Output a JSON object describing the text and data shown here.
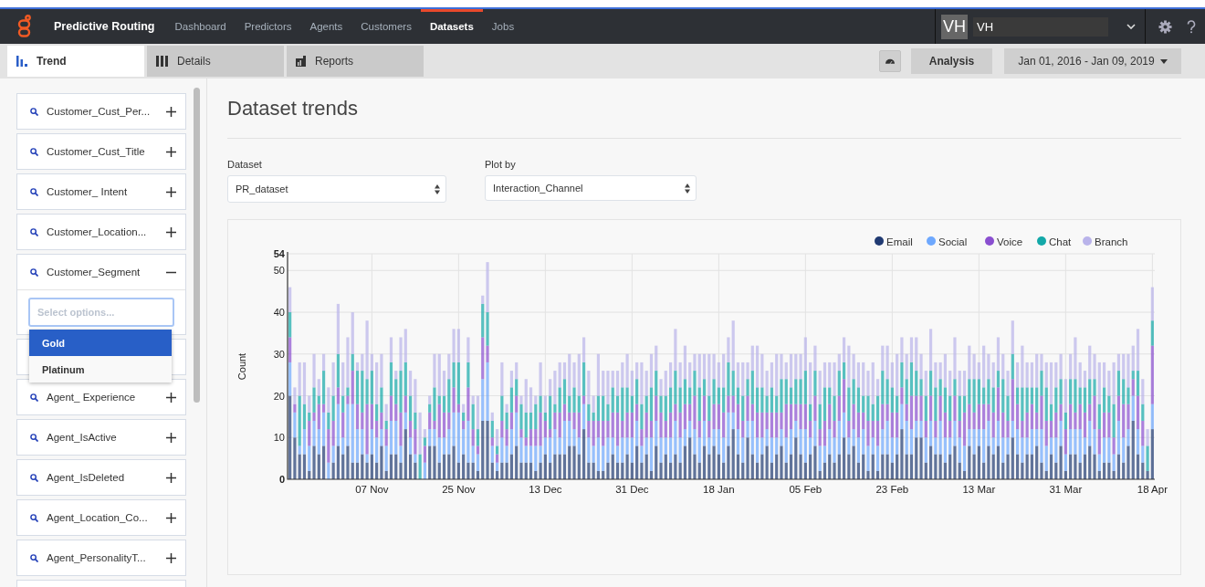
{
  "header": {
    "app_name": "Predictive Routing",
    "nav": [
      {
        "label": "Dashboard",
        "selected": false
      },
      {
        "label": "Predictors",
        "selected": false
      },
      {
        "label": "Agents",
        "selected": false
      },
      {
        "label": "Customers",
        "selected": false
      },
      {
        "label": "Datasets",
        "selected": true
      },
      {
        "label": "Jobs",
        "selected": false
      }
    ],
    "user": {
      "initials": "VH",
      "name": "VH"
    }
  },
  "tabs": [
    {
      "label": "Trend",
      "kind": "trend",
      "selected": true
    },
    {
      "label": "Details",
      "kind": "details",
      "selected": false
    },
    {
      "label": "Reports",
      "kind": "reports",
      "selected": false
    }
  ],
  "toolbar": {
    "analysis_button": "Analysis",
    "date_range": "Jan 01, 2016 - Jan 09, 2019"
  },
  "sidebar": {
    "filters": [
      {
        "name": "Customer_Cust_Per...",
        "expanded": false
      },
      {
        "name": "Customer_Cust_Title",
        "expanded": false
      },
      {
        "name": "Customer_ Intent",
        "expanded": false
      },
      {
        "name": "Customer_Location...",
        "expanded": false
      },
      {
        "name": "Customer_Segment",
        "expanded": true,
        "placeholder": "Select options...",
        "options": [
          {
            "label": "Gold",
            "selected": true
          },
          {
            "label": "Platinum",
            "selected": false
          }
        ]
      },
      {
        "kind": "covered"
      },
      {
        "name": "Agent_ Experience",
        "expanded": false
      },
      {
        "name": "Agent_IsActive",
        "expanded": false
      },
      {
        "name": "Agent_IsDeleted",
        "expanded": false
      },
      {
        "name": "Agent_Location_Co...",
        "expanded": false
      },
      {
        "name": "Agent_PersonalityT...",
        "expanded": false
      },
      {
        "kind": "covered"
      }
    ]
  },
  "main": {
    "title": "Dataset trends",
    "dataset": {
      "label": "Dataset",
      "value": "PR_dataset"
    },
    "plot_by": {
      "label": "Plot by",
      "value": "Interaction_Channel"
    },
    "chart_data": {
      "type": "bar",
      "stacked": true,
      "grid": true,
      "legend": true,
      "ylabel": "Count",
      "ylim": [
        0,
        54
      ],
      "yticks": [
        0,
        10,
        20,
        30,
        40,
        50,
        54
      ],
      "categories": [
        null,
        null,
        null,
        null,
        null,
        null,
        null,
        null,
        null,
        null,
        null,
        null,
        null,
        null,
        null,
        null,
        null,
        "07 Nov",
        null,
        null,
        null,
        null,
        null,
        null,
        null,
        null,
        null,
        null,
        null,
        null,
        null,
        null,
        null,
        null,
        null,
        "25 Nov",
        null,
        null,
        null,
        null,
        null,
        null,
        null,
        null,
        null,
        null,
        null,
        null,
        null,
        null,
        null,
        null,
        null,
        "13 Dec",
        null,
        null,
        null,
        null,
        null,
        null,
        null,
        null,
        null,
        null,
        null,
        null,
        null,
        null,
        null,
        null,
        null,
        "31 Dec",
        null,
        null,
        null,
        null,
        null,
        null,
        null,
        null,
        null,
        null,
        null,
        null,
        null,
        null,
        null,
        null,
        null,
        "18 Jan",
        null,
        null,
        null,
        null,
        null,
        null,
        null,
        null,
        null,
        null,
        null,
        null,
        null,
        null,
        null,
        null,
        null,
        "05 Feb",
        null,
        null,
        null,
        null,
        null,
        null,
        null,
        null,
        null,
        null,
        null,
        null,
        null,
        null,
        null,
        null,
        null,
        "23 Feb",
        null,
        null,
        null,
        null,
        null,
        null,
        null,
        null,
        null,
        null,
        null,
        null,
        null,
        null,
        null,
        null,
        null,
        "13 Mar",
        null,
        null,
        null,
        null,
        null,
        null,
        null,
        null,
        null,
        null,
        null,
        null,
        null,
        null,
        null,
        null,
        null,
        "31 Mar",
        null,
        null,
        null,
        null,
        null,
        null,
        null,
        null,
        null,
        null,
        null,
        null,
        null,
        null,
        null,
        null,
        null,
        "18 Apr"
      ],
      "series": [
        {
          "name": "Email",
          "color": "#203a72",
          "values": [
            20,
            10,
            6,
            6,
            2,
            8,
            6,
            8,
            0,
            4,
            8,
            6,
            8,
            4,
            4,
            6,
            4,
            6,
            4,
            8,
            2,
            6,
            6,
            4,
            12,
            6,
            4,
            0,
            0,
            8,
            8,
            4,
            6,
            6,
            8,
            4,
            6,
            4,
            4,
            2,
            14,
            14,
            4,
            2,
            4,
            4,
            6,
            8,
            4,
            4,
            4,
            2,
            4,
            6,
            4,
            6,
            6,
            6,
            8,
            8,
            6,
            12,
            4,
            4,
            2,
            2,
            4,
            6,
            4,
            4,
            6,
            4,
            8,
            4,
            6,
            2,
            8,
            4,
            6,
            4,
            6,
            4,
            8,
            10,
            6,
            4,
            8,
            6,
            8,
            6,
            4,
            8,
            12,
            6,
            4,
            10,
            6,
            4,
            6,
            8,
            4,
            6,
            8,
            4,
            6,
            10,
            6,
            4,
            6,
            8,
            2,
            4,
            6,
            4,
            6,
            10,
            6,
            8,
            4,
            6,
            2,
            6,
            2,
            6,
            6,
            4,
            6,
            12,
            6,
            6,
            10,
            10,
            4,
            8,
            6,
            6,
            4,
            6,
            8,
            4,
            2,
            8,
            6,
            8,
            4,
            8,
            6,
            8,
            4,
            6,
            10,
            6,
            4,
            6,
            6,
            8,
            4,
            2,
            6,
            4,
            8,
            2,
            6,
            6,
            4,
            6,
            8,
            6,
            2,
            4,
            4,
            2,
            6,
            4,
            8,
            14,
            6,
            4,
            2,
            12
          ]
        },
        {
          "name": "Social",
          "color": "#6ea8fe",
          "values": [
            8,
            6,
            2,
            6,
            6,
            6,
            6,
            8,
            4,
            4,
            10,
            4,
            10,
            14,
            8,
            6,
            2,
            6,
            6,
            4,
            6,
            8,
            8,
            4,
            4,
            4,
            2,
            0,
            4,
            4,
            4,
            6,
            4,
            6,
            8,
            12,
            6,
            10,
            4,
            4,
            10,
            14,
            4,
            2,
            6,
            4,
            6,
            8,
            6,
            4,
            4,
            6,
            4,
            4,
            6,
            6,
            4,
            8,
            6,
            4,
            4,
            6,
            6,
            4,
            8,
            6,
            6,
            4,
            4,
            6,
            4,
            6,
            6,
            4,
            4,
            8,
            6,
            6,
            4,
            6,
            8,
            6,
            4,
            4,
            6,
            6,
            6,
            4,
            4,
            6,
            6,
            8,
            4,
            6,
            6,
            4,
            8,
            6,
            4,
            4,
            6,
            4,
            4,
            6,
            6,
            4,
            6,
            8,
            4,
            6,
            6,
            4,
            6,
            6,
            8,
            6,
            4,
            4,
            6,
            6,
            6,
            4,
            6,
            6,
            8,
            6,
            4,
            6,
            8,
            6,
            4,
            4,
            6,
            6,
            4,
            8,
            6,
            4,
            6,
            6,
            6,
            4,
            6,
            4,
            8,
            6,
            4,
            6,
            6,
            4,
            4,
            6,
            6,
            4,
            6,
            4,
            8,
            6,
            4,
            6,
            6,
            4,
            6,
            6,
            8,
            4,
            6,
            6,
            4,
            6,
            6,
            4,
            8,
            6,
            4,
            6,
            6,
            4,
            0,
            6
          ]
        },
        {
          "name": "Voice",
          "color": "#8a4fd0",
          "values": [
            6,
            2,
            0,
            0,
            6,
            2,
            6,
            2,
            8,
            6,
            4,
            6,
            2,
            8,
            6,
            4,
            12,
            6,
            4,
            4,
            4,
            6,
            4,
            8,
            4,
            4,
            6,
            0,
            4,
            4,
            2,
            8,
            6,
            4,
            6,
            2,
            2,
            8,
            4,
            2,
            10,
            4,
            2,
            2,
            4,
            4,
            4,
            4,
            2,
            2,
            4,
            4,
            8,
            4,
            2,
            4,
            6,
            4,
            2,
            4,
            6,
            2,
            4,
            6,
            4,
            6,
            4,
            6,
            8,
            4,
            6,
            6,
            4,
            4,
            6,
            4,
            6,
            6,
            4,
            6,
            4,
            6,
            6,
            4,
            8,
            4,
            6,
            4,
            6,
            6,
            6,
            4,
            4,
            6,
            4,
            6,
            4,
            6,
            6,
            4,
            6,
            6,
            4,
            8,
            6,
            4,
            6,
            6,
            4,
            6,
            4,
            6,
            6,
            4,
            6,
            8,
            4,
            6,
            6,
            4,
            6,
            4,
            6,
            6,
            4,
            6,
            6,
            4,
            4,
            8,
            6,
            6,
            4,
            6,
            4,
            6,
            6,
            4,
            6,
            4,
            8,
            6,
            4,
            6,
            6,
            4,
            6,
            8,
            6,
            4,
            10,
            6,
            4,
            6,
            6,
            4,
            8,
            6,
            4,
            6,
            4,
            6,
            6,
            4,
            6,
            6,
            4,
            8,
            6,
            6,
            6,
            4,
            6,
            8,
            6,
            4,
            8,
            6,
            0,
            14
          ]
        },
        {
          "name": "Chat",
          "color": "#13a8a8",
          "values": [
            6,
            0,
            12,
            6,
            2,
            6,
            2,
            8,
            4,
            6,
            8,
            4,
            2,
            4,
            8,
            10,
            6,
            8,
            4,
            6,
            2,
            8,
            6,
            10,
            8,
            6,
            4,
            6,
            2,
            2,
            8,
            2,
            4,
            8,
            6,
            10,
            2,
            6,
            6,
            4,
            8,
            8,
            4,
            2,
            6,
            4,
            6,
            4,
            6,
            6,
            4,
            6,
            4,
            2,
            8,
            2,
            6,
            6,
            4,
            6,
            4,
            8,
            4,
            2,
            6,
            6,
            4,
            6,
            4,
            8,
            6,
            4,
            6,
            6,
            4,
            8,
            6,
            4,
            6,
            6,
            8,
            6,
            6,
            4,
            6,
            8,
            4,
            6,
            6,
            4,
            6,
            8,
            6,
            4,
            6,
            4,
            8,
            6,
            6,
            4,
            6,
            4,
            8,
            6,
            4,
            6,
            6,
            8,
            4,
            6,
            6,
            8,
            4,
            6,
            6,
            4,
            8,
            6,
            6,
            4,
            6,
            4,
            6,
            8,
            6,
            6,
            4,
            6,
            6,
            8,
            6,
            4,
            6,
            6,
            8,
            4,
            6,
            6,
            4,
            6,
            4,
            6,
            8,
            6,
            4,
            6,
            6,
            4,
            8,
            6,
            6,
            4,
            8,
            6,
            4,
            6,
            6,
            8,
            4,
            6,
            6,
            4,
            6,
            8,
            4,
            6,
            6,
            4,
            6,
            6,
            4,
            8,
            6,
            6,
            4,
            2,
            6,
            4,
            6,
            6
          ]
        },
        {
          "name": "Branch",
          "color": "#b9b3ea",
          "values": [
            6,
            4,
            8,
            10,
            4,
            8,
            4,
            4,
            6,
            8,
            12,
            8,
            12,
            10,
            2,
            4,
            14,
            4,
            10,
            8,
            4,
            6,
            2,
            8,
            8,
            6,
            8,
            10,
            2,
            2,
            8,
            10,
            6,
            6,
            8,
            8,
            2,
            6,
            2,
            8,
            2,
            12,
            2,
            4,
            8,
            2,
            4,
            4,
            2,
            8,
            6,
            2,
            8,
            4,
            4,
            8,
            6,
            4,
            10,
            6,
            10,
            6,
            8,
            4,
            10,
            6,
            8,
            4,
            6,
            6,
            8,
            6,
            4,
            10,
            6,
            8,
            6,
            4,
            6,
            6,
            10,
            6,
            8,
            6,
            4,
            8,
            6,
            10,
            6,
            6,
            8,
            6,
            12,
            6,
            8,
            4,
            6,
            10,
            8,
            6,
            6,
            10,
            6,
            4,
            8,
            6,
            6,
            8,
            10,
            6,
            8,
            6,
            6,
            8,
            4,
            6,
            10,
            6,
            6,
            8,
            6,
            10,
            4,
            6,
            8,
            6,
            10,
            6,
            6,
            6,
            8,
            6,
            6,
            10,
            6,
            4,
            8,
            6,
            10,
            6,
            6,
            8,
            6,
            4,
            10,
            6,
            6,
            8,
            6,
            6,
            8,
            6,
            10,
            6,
            6,
            8,
            4,
            6,
            10,
            6,
            6,
            8,
            6,
            10,
            6,
            4,
            8,
            6,
            10,
            6,
            6,
            10,
            4,
            6,
            8,
            6,
            10,
            6,
            4,
            8
          ]
        }
      ]
    }
  }
}
